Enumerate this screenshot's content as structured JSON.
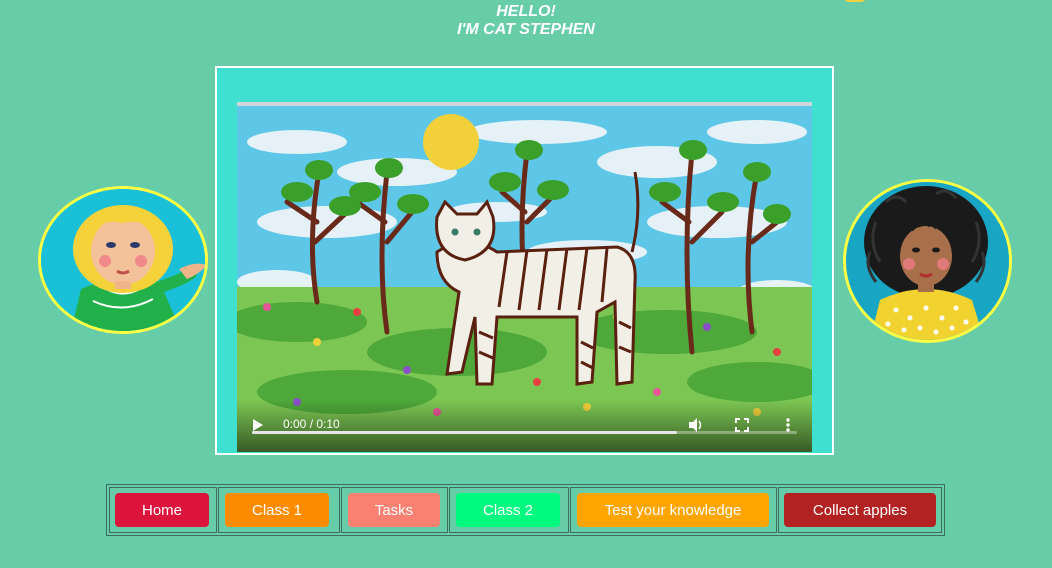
{
  "header": {
    "line1": "HELLO!",
    "line2": "I'M CAT STEPHEN"
  },
  "video": {
    "time": "0:00 / 0:10",
    "progress_fraction": 0.78,
    "play_icon": "play-icon",
    "volume_icon": "volume-icon",
    "fullscreen_icon": "fullscreen-icon",
    "more_icon": "more-vertical-icon"
  },
  "colors": {
    "background": "#66cda8",
    "frame": "#3fe0d0",
    "avatar_border": "#ffff44"
  },
  "nav": {
    "buttons": [
      {
        "label": "Home",
        "color": "#dc143c"
      },
      {
        "label": "Class 1",
        "color": "#ff8c00"
      },
      {
        "label": "Tasks",
        "color": "#fa8072"
      },
      {
        "label": "Class 2",
        "color": "#00fa7f"
      },
      {
        "label": "Test your knowledge",
        "color": "#ffa500"
      },
      {
        "label": "Collect apples",
        "color": "#b22222"
      }
    ]
  }
}
